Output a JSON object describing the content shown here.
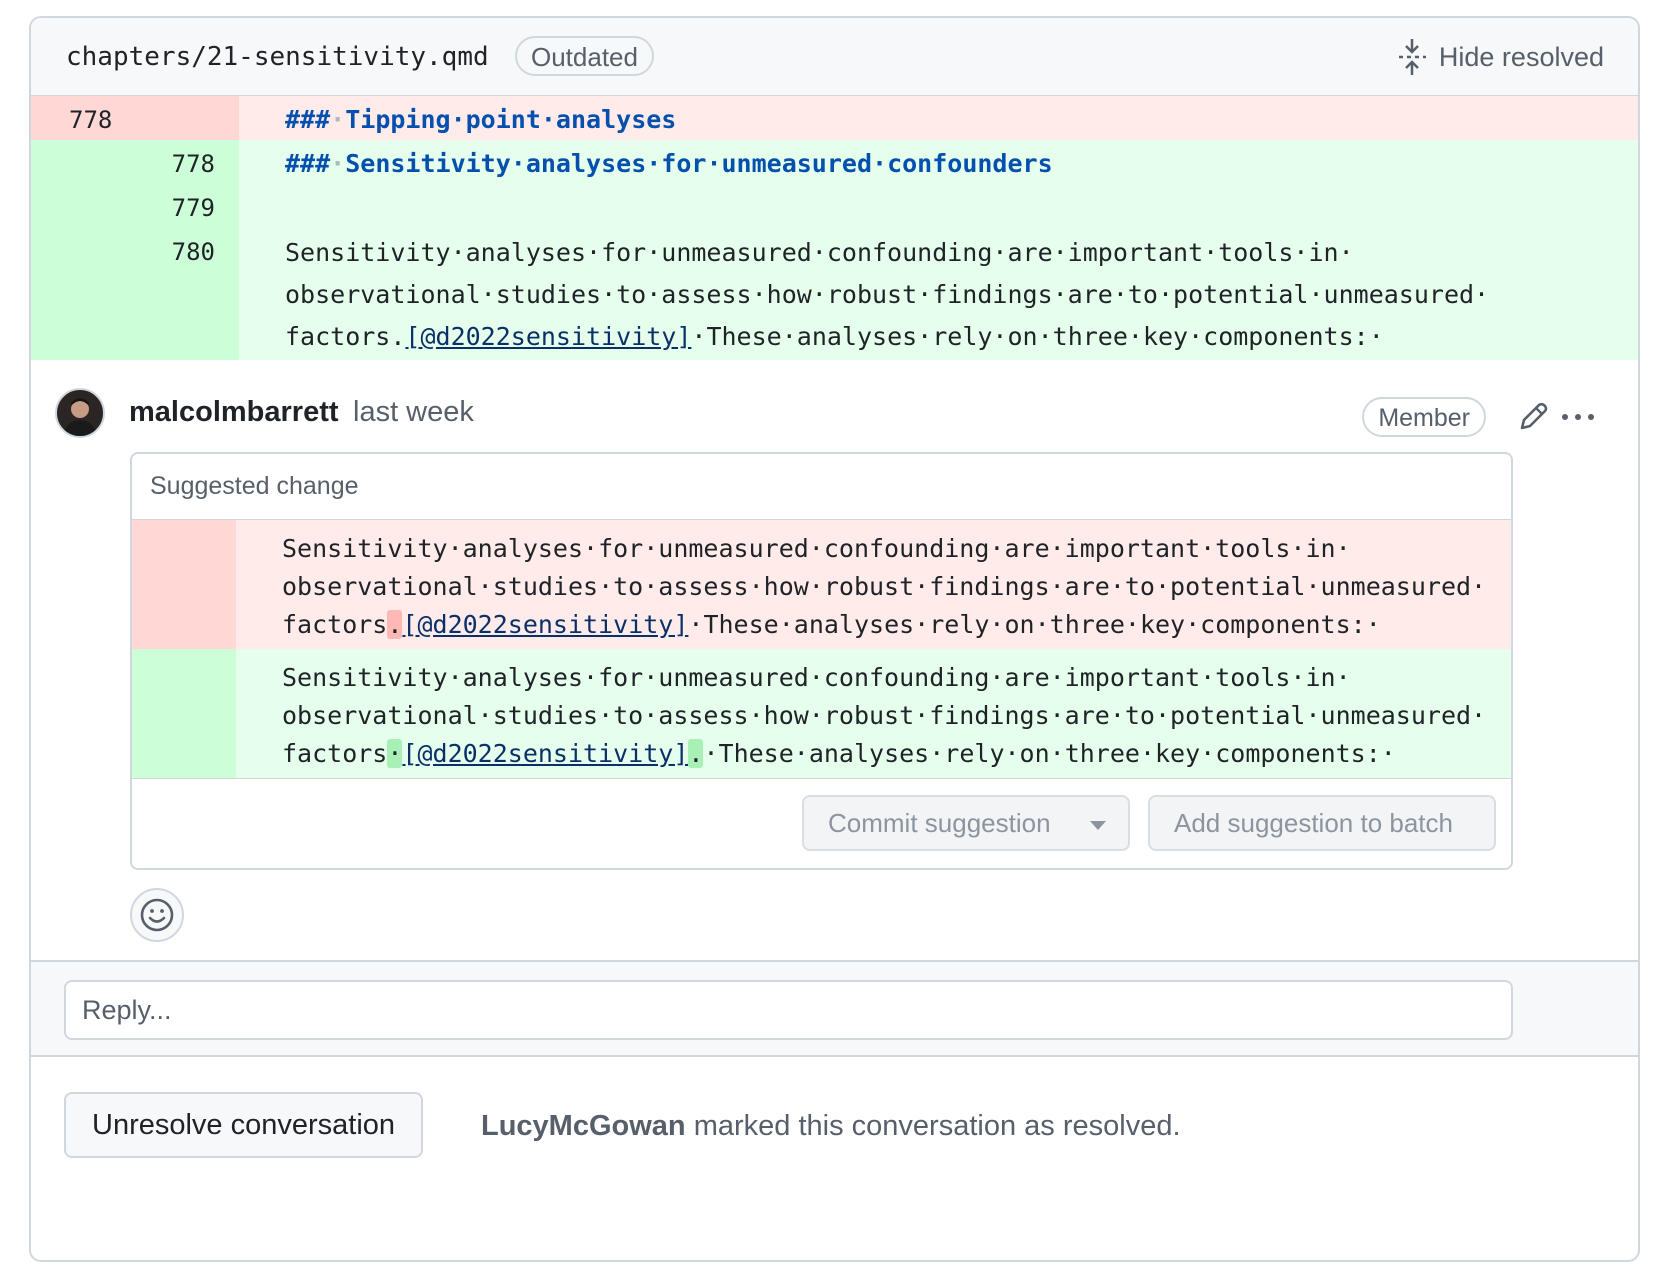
{
  "header": {
    "filename": "chapters/21-sensitivity.qmd",
    "badge": "Outdated",
    "hide_resolved": "Hide resolved",
    "hide_resolved_icon": "fold-icon"
  },
  "diff": {
    "removed": {
      "old_line": "778",
      "hash": "###",
      "text": "Tipping·point·analyses"
    },
    "added": [
      {
        "new_line": "778",
        "hash": "###",
        "text": "Sensitivity·analyses·for·unmeasured·confounders"
      },
      {
        "new_line": "779",
        "text": ""
      },
      {
        "new_line": "780",
        "line1": "Sensitivity·analyses·for·unmeasured·confounding·are·important·tools·in·",
        "line2": "observational·studies·to·assess·how·robust·findings·are·to·potential·unmeasured·",
        "line3_a": "factors.",
        "line3_cite": "[@d2022sensitivity]",
        "line3_b": "·These·analyses·rely·on·three·key·components:·"
      }
    ]
  },
  "comment": {
    "author": "malcolmbarrett",
    "time": "last week",
    "role": "Member",
    "suggestion_title": "Suggested change",
    "old": {
      "line1": "Sensitivity·analyses·for·unmeasured·confounding·are·important·tools·in·",
      "line2": "observational·studies·to·assess·how·robust·findings·are·to·potential·unmeasured·",
      "pre": "factors",
      "mark": ".",
      "cite": "[@d2022sensitivity]",
      "post": "·These·analyses·rely·on·three·key·components:·"
    },
    "new": {
      "line1": "Sensitivity·analyses·for·unmeasured·confounding·are·important·tools·in·",
      "line2": "observational·studies·to·assess·how·robust·findings·are·to·potential·unmeasured·",
      "pre": "factors",
      "mark1": "·",
      "cite": "[@d2022sensitivity]",
      "mark2": ".",
      "post": "·These·analyses·rely·on·three·key·components:·"
    },
    "commit_label": "Commit suggestion",
    "batch_label": "Add suggestion to batch"
  },
  "reply": {
    "placeholder": "Reply..."
  },
  "footer": {
    "unresolve_label": "Unresolve conversation",
    "resolver": "LucyMcGowan",
    "resolved_text": "marked this conversation as resolved."
  }
}
